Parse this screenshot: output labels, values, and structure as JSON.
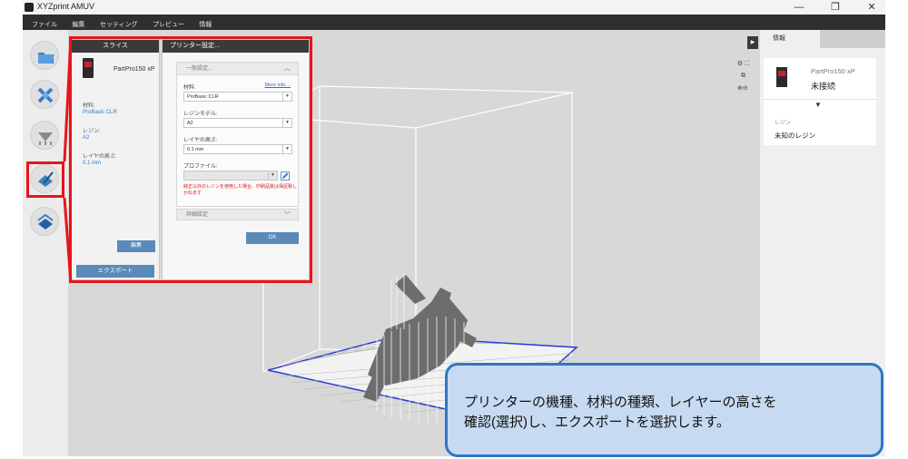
{
  "window": {
    "title": "XYZprint AMUV",
    "minimize": "—",
    "restore": "❐",
    "close": "✕"
  },
  "menu": [
    "ファイル",
    "編集",
    "セッティング",
    "プレビュー",
    "情報"
  ],
  "toolbar": {
    "icons": [
      "open-folder-icon",
      "arrange-icon",
      "support-icon",
      "slice-icon",
      "export-layers-icon"
    ]
  },
  "slice_panel": {
    "title": "スライス",
    "printer": "PartPro150 xP",
    "material_label": "材料:",
    "material_value": "ProBasic CLR",
    "resin_label": "レジン:",
    "resin_value": "A2",
    "layer_label": "レイヤの高さ:",
    "layer_value": "0.1 mm",
    "edit_button": "編集",
    "export_button": "エクスポート"
  },
  "printer_settings": {
    "title": "プリンター設定…",
    "general_section": "一般設定…",
    "material_label": "材料:",
    "more_info": "More info…",
    "material_value": "ProBasic CLR",
    "resin_model_label": "レジンモデル:",
    "resin_model_value": "A2",
    "layer_height_label": "レイヤの高さ:",
    "layer_height_value": "0.1 mm",
    "profile_label": "プロファイル:",
    "profile_value": "",
    "warning": "純正以外のレジンを使用した場合、印刷品質は保証致しかねます",
    "advanced_section": "詳細設定",
    "ok_button": "OK"
  },
  "right_panel": {
    "tab": "情報",
    "printer_name": "PartPro150 xP",
    "status": "未接続",
    "resin_label": "レジン",
    "resin_value": "未知のレジン"
  },
  "colors": {
    "highlight": "#e8141b",
    "accent": "#5a8ab8",
    "callout_fill": "#c6daf1",
    "callout_border": "#2e76c5"
  },
  "callout": {
    "line1": "プリンターの機種、材料の種類、レイヤーの高さを",
    "line2": "確認(選択)し、エクスポートを選択します。"
  }
}
